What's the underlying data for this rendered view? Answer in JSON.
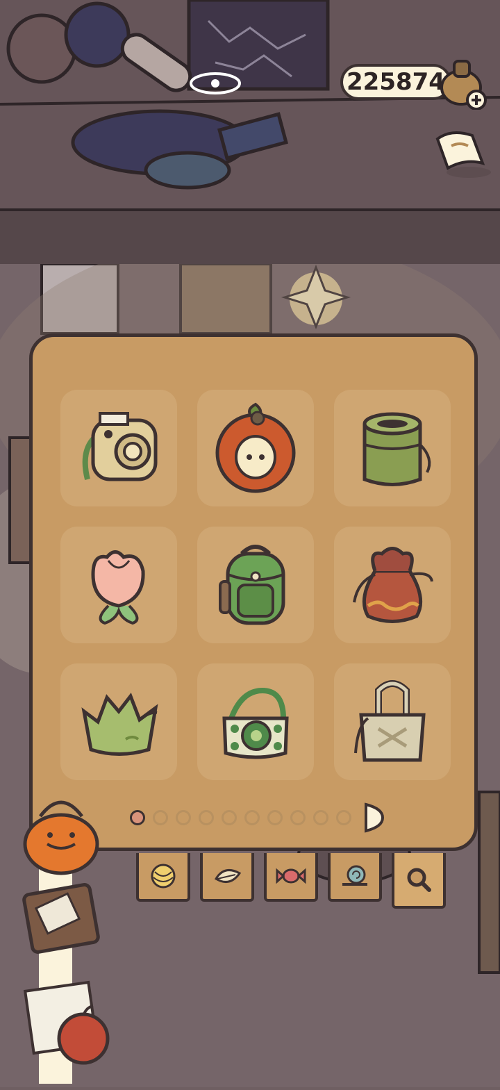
{
  "header": {
    "coins": "225874",
    "coin_icon": "acorn-bag-icon",
    "add_icon": "plus-icon",
    "map_icon": "map-scroll-icon"
  },
  "backpack_panel": {
    "items": [
      {
        "name": "instant-camera-bag",
        "icon": "camera-bag-icon"
      },
      {
        "name": "apple-pouch",
        "icon": "apple-pouch-icon"
      },
      {
        "name": "green-bucket-bag",
        "icon": "bucket-bag-icon"
      },
      {
        "name": "tulip-bag",
        "icon": "tulip-bag-icon"
      },
      {
        "name": "green-backpack",
        "icon": "backpack-icon"
      },
      {
        "name": "red-drawstring-pouch",
        "icon": "drawstring-pouch-icon"
      },
      {
        "name": "leaf-crown-bag",
        "icon": "leaf-bag-icon"
      },
      {
        "name": "crochet-tote",
        "icon": "crochet-tote-icon"
      },
      {
        "name": "woven-tote",
        "icon": "woven-tote-icon"
      }
    ],
    "pages": {
      "total": 10,
      "current": 1
    }
  },
  "tabs": [
    {
      "name": "yarn-tab",
      "icon": "yarn-icon"
    },
    {
      "name": "leaf-tab",
      "icon": "leaf-icon"
    },
    {
      "name": "candy-tab",
      "icon": "candy-icon"
    },
    {
      "name": "snail-tab",
      "icon": "snail-icon"
    },
    {
      "name": "search-tab",
      "icon": "magnifier-icon",
      "active": true
    }
  ],
  "colors": {
    "panel": "#c89b64",
    "cell": "#cfa672",
    "outline": "#3d3131",
    "active_dot": "#d9937b",
    "background": "#6f5f62"
  }
}
